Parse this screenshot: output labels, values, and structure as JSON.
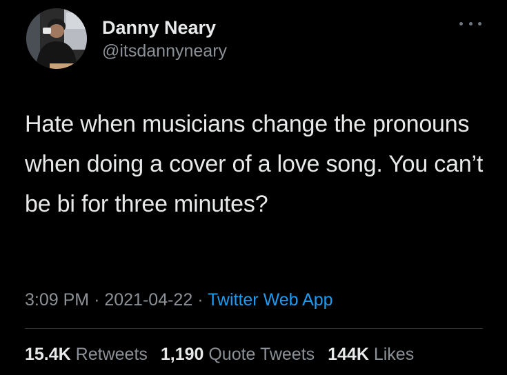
{
  "tweet": {
    "author": {
      "display_name": "Danny Neary",
      "handle": "@itsdannyneary"
    },
    "text": "Hate when musicians change the pronouns when doing a cover of a love song. You can’t be bi for three minutes?",
    "time": "3:09 PM",
    "separator": "·",
    "date": "2021-04-22",
    "source": "Twitter Web App",
    "stats": {
      "retweets": {
        "count": "15.4K",
        "label": "Retweets"
      },
      "quote_tweets": {
        "count": "1,190",
        "label": "Quote Tweets"
      },
      "likes": {
        "count": "144K",
        "label": "Likes"
      }
    }
  },
  "icons": {
    "more": "more-horizontal-icon",
    "avatar": "profile-photo"
  },
  "colors": {
    "background": "#000000",
    "primary_text": "#e7e9ea",
    "secondary_text": "#8b9196",
    "link": "#1d9bf0",
    "divider": "#2f3336"
  }
}
